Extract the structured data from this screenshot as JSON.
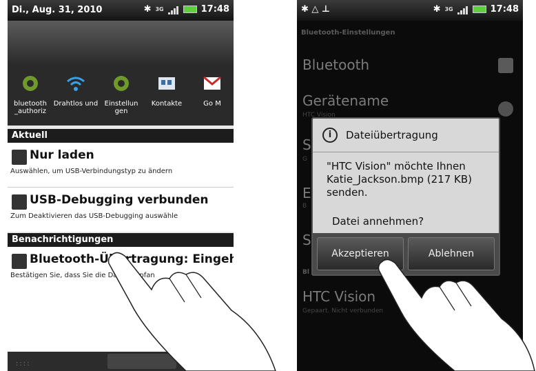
{
  "left": {
    "status": {
      "date": "Di., Aug. 31, 2010",
      "time": "17:48",
      "network": "3G"
    },
    "tray": [
      {
        "label": "bluetooth _authoriz",
        "icon": "gear-icon"
      },
      {
        "label": "Drahtlos und",
        "icon": "wifi-icon"
      },
      {
        "label": "Einstellun gen",
        "icon": "gear-icon"
      },
      {
        "label": "Kontakte",
        "icon": "contacts-icon"
      },
      {
        "label": "Go M",
        "icon": "gmail-icon"
      }
    ],
    "sections": {
      "current": "Aktuell",
      "notifications": "Benachrichtigungen"
    },
    "notes": [
      {
        "title": "Nur laden",
        "sub": "Auswählen, um USB-Verbindungstyp zu ändern",
        "icon": "usb-icon"
      },
      {
        "title": "USB-Debugging verbunden",
        "sub": "Zum Deaktivieren das USB-Debugging auswähle",
        "icon": "warning-icon"
      },
      {
        "title": "Bluetooth-Übertragung: Eingehe",
        "sub": "Bestätigen Sie, dass Sie die Datei empfan",
        "icon": "bluetooth-icon"
      }
    ]
  },
  "right": {
    "status": {
      "time": "17:48",
      "network": "3G"
    },
    "settings_title": "Bluetooth-Einstellungen",
    "settings": {
      "bluetooth": "Bluetooth",
      "device_name": "Gerätename",
      "device_name_sub": "HTC Vision",
      "s1": "S",
      "s1_sub": "G",
      "e1": "E",
      "e1_sub": "B",
      "s2": "S",
      "paired_header": "Bl",
      "htc": "HTC Vision",
      "htc_sub": "Gepaart. Nicht verbunden"
    },
    "dialog": {
      "title": "Dateiübertragung",
      "message": "\"HTC Vision\" möchte Ihnen Katie_Jackson.bmp (217 KB) senden.",
      "question": "Datei annehmen?",
      "accept": "Akzeptieren",
      "decline": "Ablehnen"
    }
  },
  "colors": {
    "accent_battery": "#5fcf3f",
    "dialog_bg": "#d8d8d8"
  }
}
